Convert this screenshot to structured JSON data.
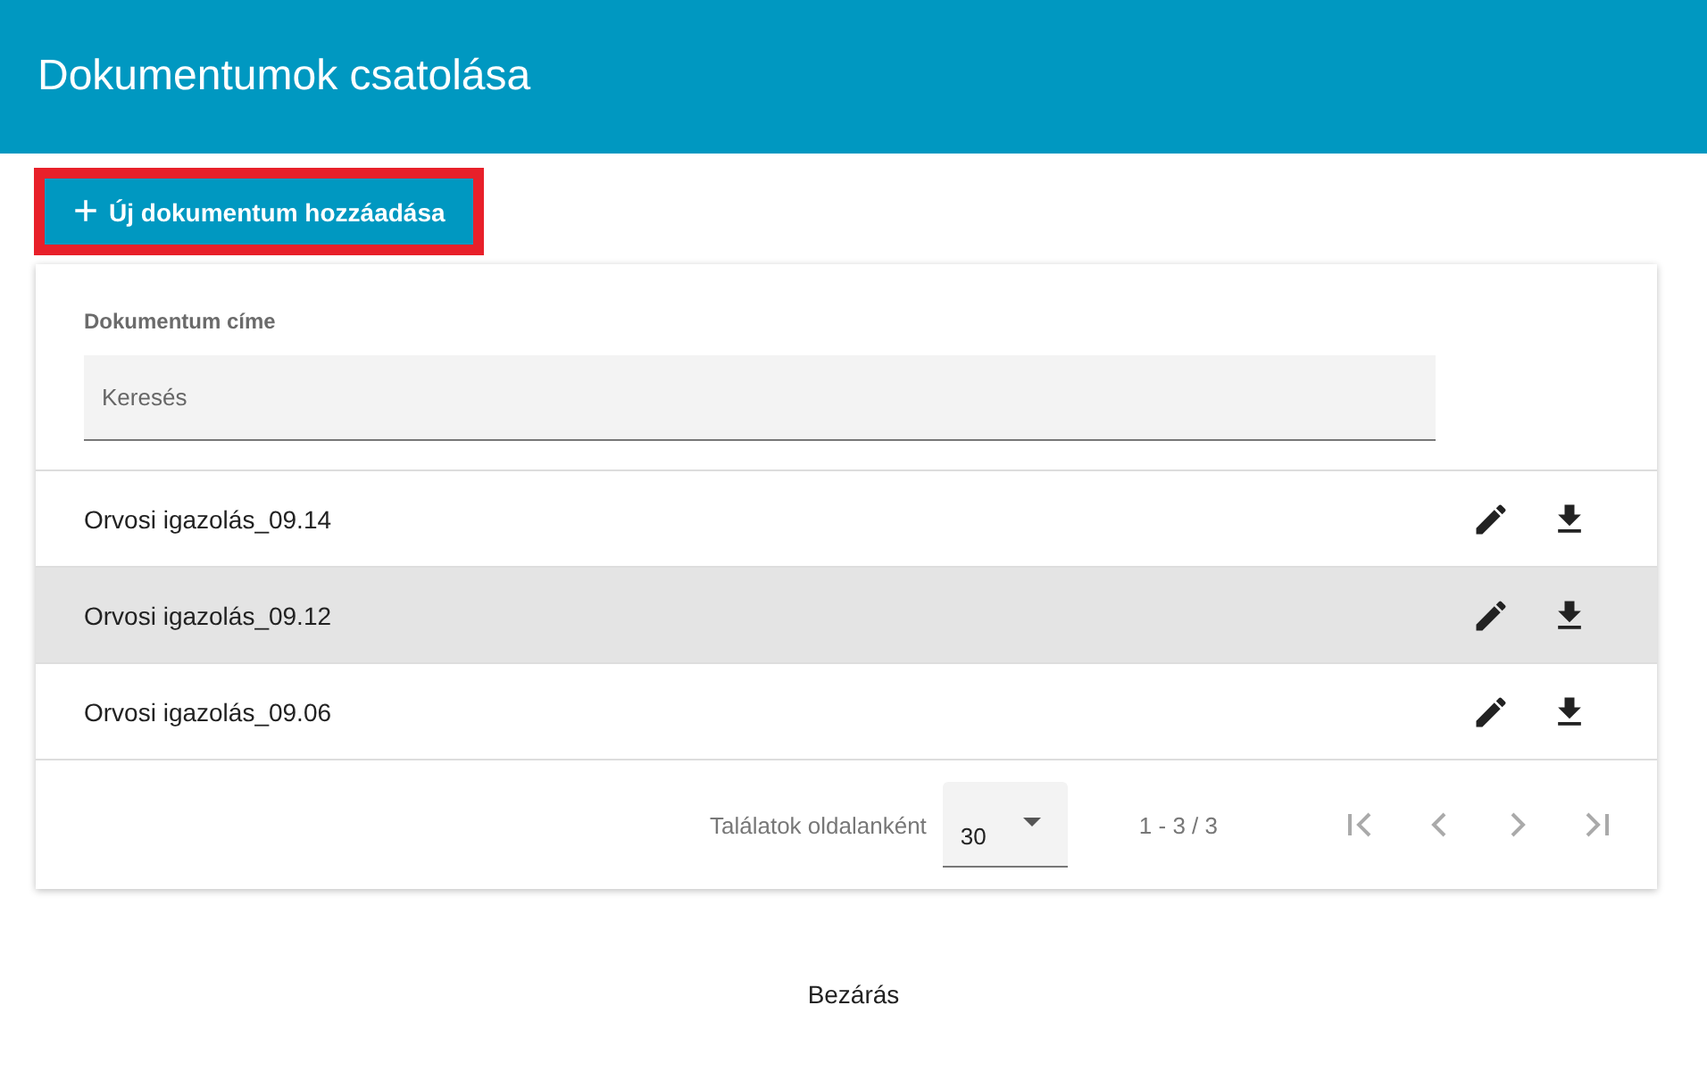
{
  "dialog": {
    "title": "Dokumentumok csatolása"
  },
  "add_button": {
    "label": "Új dokumentum hozzáadása",
    "icon": "+",
    "highlighted": true
  },
  "filter": {
    "label": "Dokumentum címe",
    "placeholder": "Keresés"
  },
  "rows": [
    {
      "name": "Orvosi igazolás_09.14",
      "highlighted": false
    },
    {
      "name": "Orvosi igazolás_09.12",
      "highlighted": true
    },
    {
      "name": "Orvosi igazolás_09.06",
      "highlighted": false
    }
  ],
  "pagination": {
    "label": "Találatok oldalanként",
    "page_size": "30",
    "range": "1 - 3 / 3"
  },
  "close_button": "Bezárás"
}
